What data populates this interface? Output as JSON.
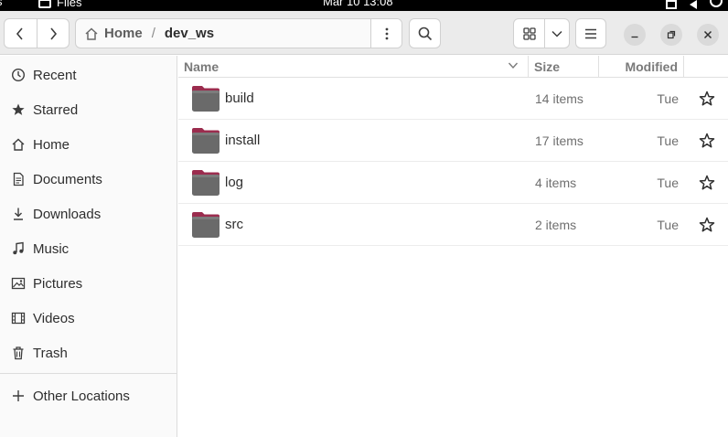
{
  "topbar": {
    "app_name": "Files",
    "clock": "Mar 10  13:08"
  },
  "header": {
    "breadcrumb": {
      "home_label": "Home",
      "separator": "/",
      "current": "dev_ws"
    }
  },
  "sidebar": {
    "items": [
      {
        "label": "Recent",
        "icon": "clock-icon"
      },
      {
        "label": "Starred",
        "icon": "star-icon"
      },
      {
        "label": "Home",
        "icon": "home-icon"
      },
      {
        "label": "Documents",
        "icon": "document-icon"
      },
      {
        "label": "Downloads",
        "icon": "download-icon"
      },
      {
        "label": "Music",
        "icon": "music-icon"
      },
      {
        "label": "Pictures",
        "icon": "picture-icon"
      },
      {
        "label": "Videos",
        "icon": "video-icon"
      },
      {
        "label": "Trash",
        "icon": "trash-icon"
      }
    ],
    "other_locations": "Other Locations"
  },
  "list": {
    "columns": {
      "name": "Name",
      "size": "Size",
      "modified": "Modified"
    },
    "rows": [
      {
        "name": "build",
        "size": "14 items",
        "modified": "Tue"
      },
      {
        "name": "install",
        "size": "17 items",
        "modified": "Tue"
      },
      {
        "name": "log",
        "size": "4 items",
        "modified": "Tue"
      },
      {
        "name": "src",
        "size": "2 items",
        "modified": "Tue"
      }
    ]
  },
  "colors": {
    "folder_body": "#6a6a6a",
    "folder_tab": "#9b2c4e",
    "headerbar_bg": "#ebebeb",
    "sidebar_bg": "#fafafa"
  }
}
